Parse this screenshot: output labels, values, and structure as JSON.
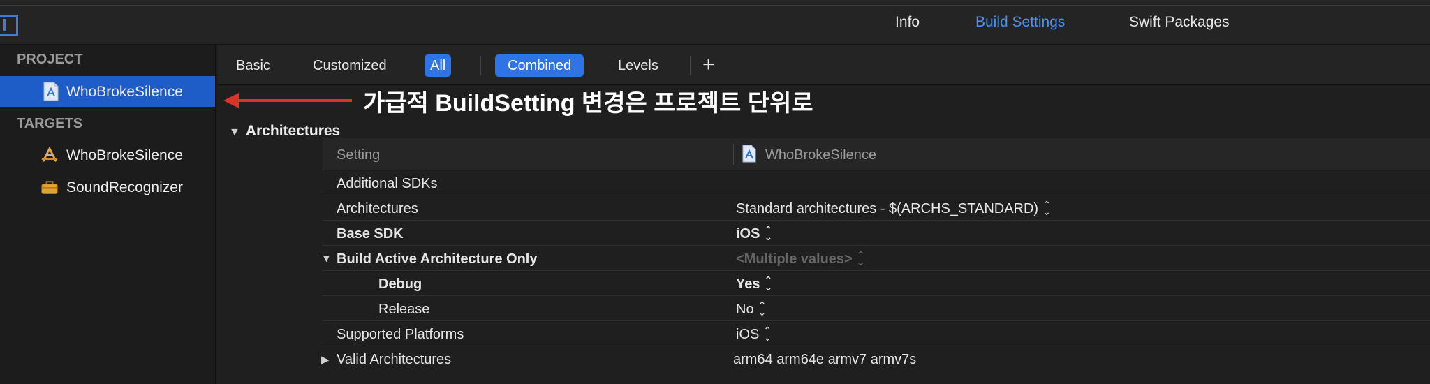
{
  "topbar": {
    "tabs": [
      {
        "label": "Info",
        "active": false
      },
      {
        "label": "Build Settings",
        "active": true
      },
      {
        "label": "Swift Packages",
        "active": false
      }
    ],
    "accent": "#4a90f5"
  },
  "sidebar": {
    "project_header": "PROJECT",
    "project_item": {
      "label": "WhoBrokeSilence",
      "icon": "project-file-icon",
      "selected": true
    },
    "targets_header": "TARGETS",
    "targets": [
      {
        "label": "WhoBrokeSilence",
        "icon": "app-target-icon"
      },
      {
        "label": "SoundRecognizer",
        "icon": "toolbox-icon"
      }
    ],
    "selection_color": "#1e5cc8"
  },
  "filterbar": {
    "basic": "Basic",
    "customized": "Customized",
    "all": "All",
    "combined": "Combined",
    "levels": "Levels",
    "plus": "+"
  },
  "annotation": {
    "text": "가급적 BuildSetting 변경은 프로젝트 단위로",
    "arrow_color": "#d9342b"
  },
  "settings": {
    "group_title": "Architectures",
    "column_setting": "Setting",
    "column_target": "WhoBrokeSilence",
    "rows": [
      {
        "name": "Additional SDKs",
        "value": ""
      },
      {
        "name": "Architectures",
        "value": "Standard architectures  -  $(ARCHS_STANDARD)"
      },
      {
        "name": "Base SDK",
        "value": "iOS"
      },
      {
        "name": "Build Active Architecture Only",
        "value": "<Multiple values>"
      },
      {
        "name": "Debug",
        "value": "Yes"
      },
      {
        "name": "Release",
        "value": "No"
      },
      {
        "name": "Supported Platforms",
        "value": "iOS"
      },
      {
        "name": "Valid Architectures",
        "value": "arm64 arm64e armv7 armv7s"
      }
    ]
  }
}
